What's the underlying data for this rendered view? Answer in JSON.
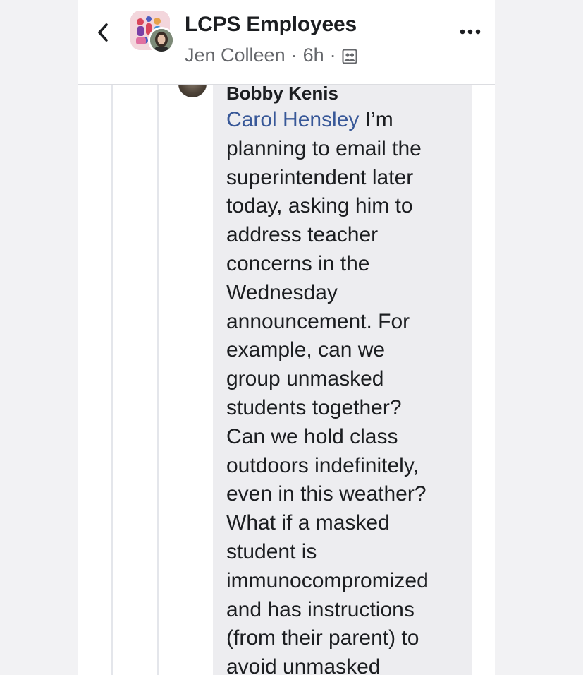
{
  "header": {
    "group_name": "LCPS Employees",
    "author": "Jen Colleen",
    "separator": "·",
    "time": "6h",
    "back_icon": "chevron-left-icon",
    "more_icon": "more-horizontal-icon",
    "audience_icon": "group-audience-icon"
  },
  "comment": {
    "author": "Bobby Kenis",
    "mention": "Carol Hensley",
    "mention_color": "#385898",
    "lines": [
      " I’m",
      "planning to email the",
      "superintendent later",
      "today, asking him to",
      "address teacher",
      "concerns in the",
      "Wednesday",
      "announcement. For",
      "example, can we",
      "group unmasked",
      "students together?",
      "Can we hold class",
      "outdoors indefinitely,",
      "even in this weather?",
      "What if a masked",
      "student is",
      "immunocompromized",
      "and has instructions",
      "(from their parent) to",
      "avoid unmasked"
    ]
  }
}
